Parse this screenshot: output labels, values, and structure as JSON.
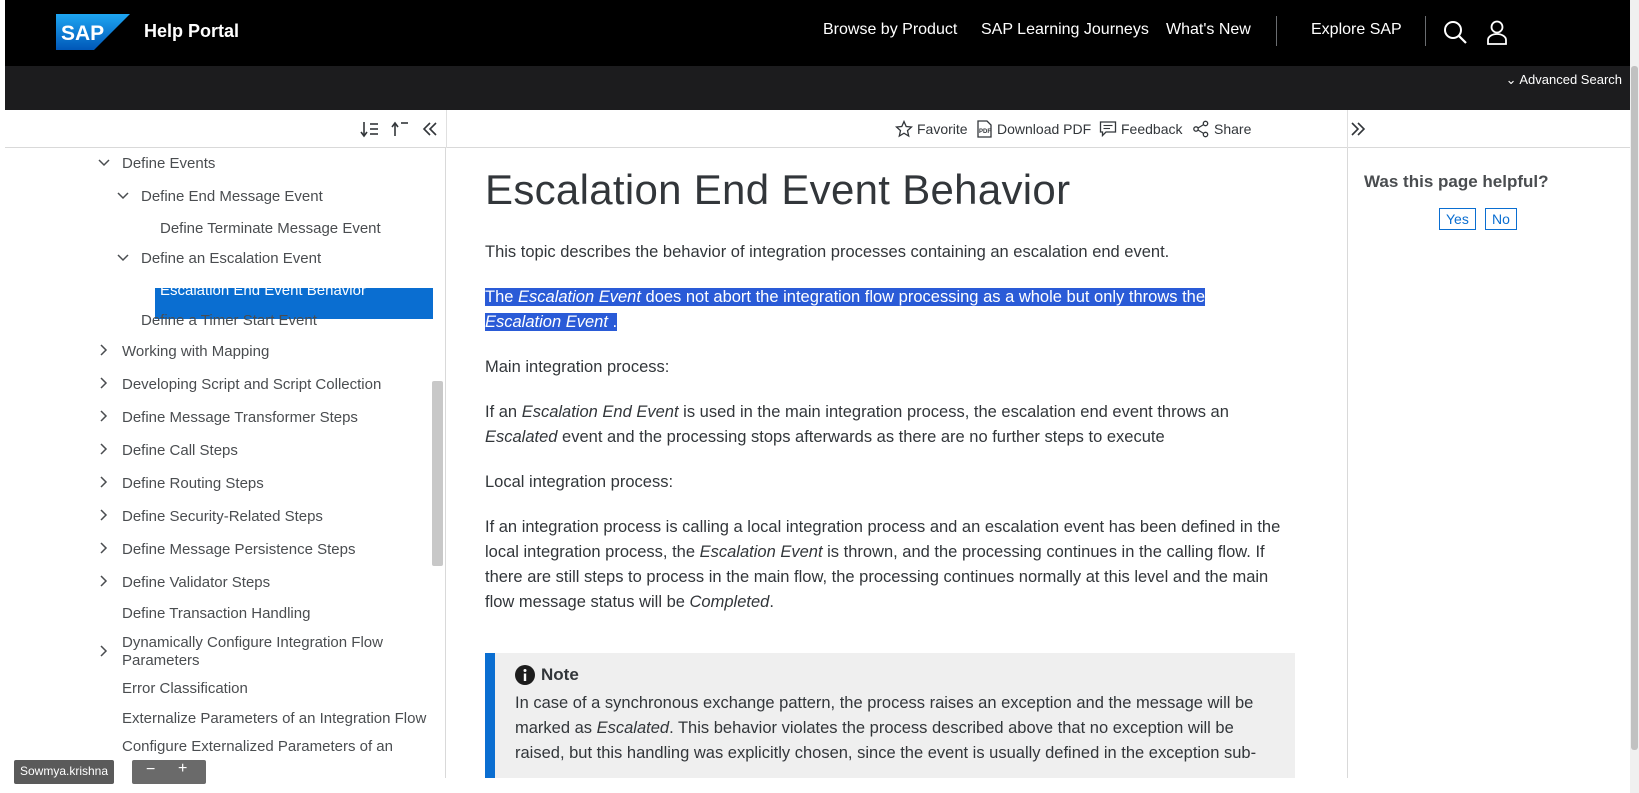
{
  "header": {
    "logo_text": "SAP",
    "title": "Help Portal",
    "nav": [
      "Browse by Product",
      "SAP Learning Journeys",
      "What's New",
      "Explore SAP"
    ],
    "advanced_search": "Advanced Search"
  },
  "toolbar": {
    "favorite": "Favorite",
    "download_pdf": "Download PDF",
    "feedback": "Feedback",
    "share": "Share"
  },
  "sidebar": {
    "items": [
      {
        "label": "Define Events",
        "expanded": true
      },
      {
        "label": "Define End Message Event",
        "expanded": true
      },
      {
        "label": "Define Terminate Message Event"
      },
      {
        "label": "Define an Escalation Event",
        "expanded": true
      },
      {
        "label": "Escalation End Event Behavior",
        "active": true
      },
      {
        "label": "Define a Timer Start Event"
      },
      {
        "label": "Working with Mapping",
        "expanded": false
      },
      {
        "label": "Developing Script and Script Collection",
        "expanded": false
      },
      {
        "label": "Define Message Transformer Steps",
        "expanded": false
      },
      {
        "label": "Define Call Steps",
        "expanded": false
      },
      {
        "label": "Define Routing Steps",
        "expanded": false
      },
      {
        "label": "Define Security-Related Steps",
        "expanded": false
      },
      {
        "label": "Define Message Persistence Steps",
        "expanded": false
      },
      {
        "label": "Define Validator Steps",
        "expanded": false
      },
      {
        "label": "Define Transaction Handling"
      },
      {
        "label": "Dynamically Configure Integration Flow Parameters",
        "expanded": false
      },
      {
        "label": "Error Classification"
      },
      {
        "label": "Externalize Parameters of an Integration Flow"
      },
      {
        "label": "Configure Externalized Parameters of an"
      }
    ]
  },
  "content": {
    "title": "Escalation End Event Behavior",
    "intro": "This topic describes the behavior of integration processes containing an escalation end event.",
    "p1_a": "The ",
    "p1_em1": "Escalation Event",
    "p1_b": " does not abort the integration flow processing as a whole but only throws the",
    "p1_em2": "Escalation Event",
    "p1_c": " .",
    "main_heading": "Main integration process:",
    "p2_a": "If an ",
    "p2_em1": "Escalation End Event",
    "p2_b": " is used in the main integration process, the escalation end event throws an",
    "p2_em2": "Escalated",
    "p2_c": " event and the processing stops afterwards as there are no further steps to execute",
    "local_heading": "Local integration process:",
    "p3_a": "If an integration process is calling a local integration process and an escalation event has been defined in the local integration process, the ",
    "p3_em1": "Escalation Event",
    "p3_b": " is thrown, and the processing continues in the calling flow. If there are still steps to process in the main flow, the processing continues normally at this level and the main flow message status will be ",
    "p3_em2": "Completed",
    "p3_c": ".",
    "note_title": "Note",
    "note_a": "In case of a synchronous exchange pattern, the process raises an exception and the message will be marked as ",
    "note_em": "Escalated",
    "note_b": ". This behavior violates the process described above that no exception will be raised, but this handling was explicitly chosen, since the event is usually defined in the exception sub-"
  },
  "feedback_panel": {
    "question": "Was this page helpful?",
    "yes": "Yes",
    "no": "No"
  },
  "overlay": {
    "user": "Sowmya.krishna",
    "minus": "−",
    "plus": "+"
  },
  "colors": {
    "accent": "#0a6ed1",
    "header_bg": "#000000",
    "selection": "#2a5bd7"
  }
}
